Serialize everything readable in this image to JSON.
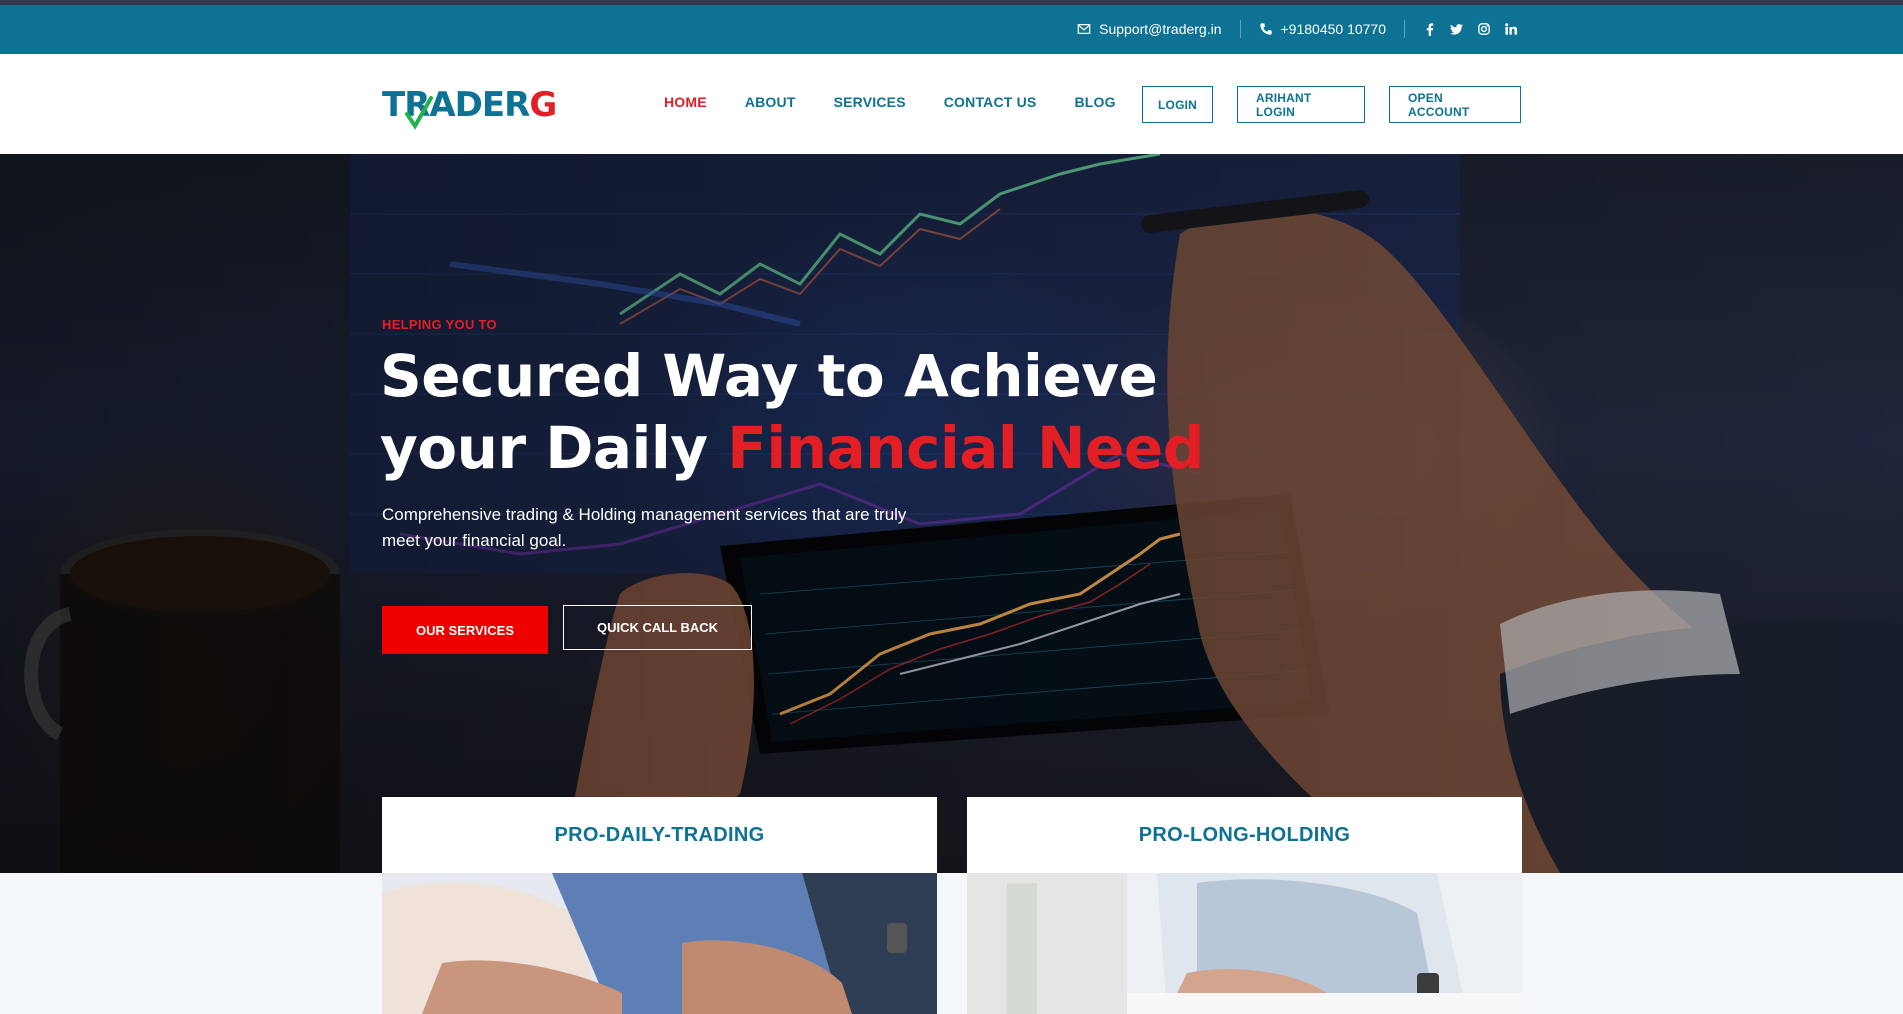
{
  "topbar": {
    "email": "Support@traderg.in",
    "phone": "+9180450 10770",
    "social": [
      "facebook-icon",
      "twitter-icon",
      "instagram-icon",
      "linkedin-icon"
    ]
  },
  "logo": {
    "part1": "TRADER",
    "part2": "G"
  },
  "nav": [
    {
      "label": "HOME",
      "active": true
    },
    {
      "label": "ABOUT"
    },
    {
      "label": "SERVICES"
    },
    {
      "label": "CONTACT US"
    },
    {
      "label": "BLOG"
    }
  ],
  "header_buttons": [
    "LOGIN",
    "ARIHANT LOGIN",
    "OPEN ACCOUNT"
  ],
  "hero": {
    "eyebrow": "HELPING YOU TO",
    "headline_line1": "Secured Way to Achieve",
    "headline_line2_white": "your Daily ",
    "headline_line2_red": "Financial Need",
    "subtext": "Comprehensive trading & Holding management services that are truly meet your financial goal.",
    "primary_button": "OUR SERVICES",
    "secondary_button": "QUICK CALL BACK"
  },
  "cards": [
    {
      "title": "PRO-DAILY-TRADING"
    },
    {
      "title": "PRO-LONG-HOLDING"
    }
  ],
  "colors": {
    "brand_blue": "#0e7294",
    "accent_red": "#e31e24",
    "button_red": "#ee0000"
  }
}
